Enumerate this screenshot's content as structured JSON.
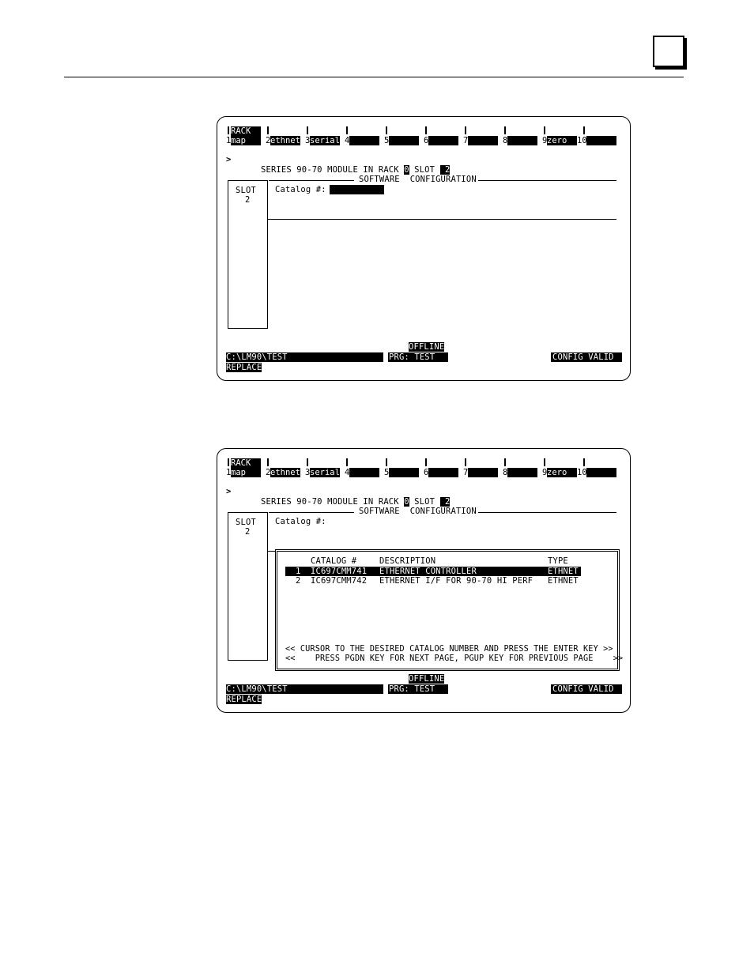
{
  "screens": [
    {
      "fkeys": [
        {
          "num": "1",
          "label": "map",
          "top": "RACK"
        },
        {
          "num": "2",
          "label": "ethnet"
        },
        {
          "num": "3",
          "label": "serial"
        },
        {
          "num": "4",
          "label": ""
        },
        {
          "num": "5",
          "label": ""
        },
        {
          "num": "6",
          "label": ""
        },
        {
          "num": "7",
          "label": ""
        },
        {
          "num": "8",
          "label": ""
        },
        {
          "num": "9",
          "label": "zero"
        },
        {
          "num": "10",
          "label": ""
        }
      ],
      "prompt": ">",
      "module_line": {
        "prefix": "SERIES 90-70 MODULE IN RACK ",
        "rack": "0",
        "slot_label": " SLOT ",
        "slot": " 2"
      },
      "section_title": "SOFTWARE  CONFIGURATION",
      "slot_label": "SLOT",
      "slot_num": "2",
      "catalog_label": "Catalog #:",
      "status": {
        "mode": "OFFLINE",
        "path": "C:\\LM90\\TEST",
        "prg": "PRG: TEST",
        "config": "CONFIG VALID",
        "action": "REPLACE"
      }
    },
    {
      "fkeys": [
        {
          "num": "1",
          "label": "map",
          "top": "RACK"
        },
        {
          "num": "2",
          "label": "ethnet"
        },
        {
          "num": "3",
          "label": "serial"
        },
        {
          "num": "4",
          "label": ""
        },
        {
          "num": "5",
          "label": ""
        },
        {
          "num": "6",
          "label": ""
        },
        {
          "num": "7",
          "label": ""
        },
        {
          "num": "8",
          "label": ""
        },
        {
          "num": "9",
          "label": "zero"
        },
        {
          "num": "10",
          "label": ""
        }
      ],
      "prompt": ">",
      "module_line": {
        "prefix": "SERIES 90-70 MODULE IN RACK ",
        "rack": "0",
        "slot_label": " SLOT ",
        "slot": " 2"
      },
      "section_title": "SOFTWARE  CONFIGURATION",
      "slot_label": "SLOT",
      "slot_num": "2",
      "catalog_label": "Catalog #:",
      "popup": {
        "headers": {
          "catalog": "CATALOG #",
          "description": "DESCRIPTION",
          "type": "TYPE"
        },
        "rows": [
          {
            "num": "1",
            "catalog": "IC697CMM741",
            "description": "ETHERNET CONTROLLER",
            "type": "ETHNET"
          },
          {
            "num": "2",
            "catalog": "IC697CMM742",
            "description": "ETHERNET I/F FOR 90-70 HI PERF",
            "type": "ETHNET"
          }
        ],
        "help1": "<< CURSOR TO THE DESIRED CATALOG NUMBER AND PRESS THE ENTER KEY >>",
        "help2": "<<    PRESS PGDN KEY FOR NEXT PAGE, PGUP KEY FOR PREVIOUS PAGE    >>"
      },
      "status": {
        "mode": "OFFLINE",
        "path": "C:\\LM90\\TEST",
        "prg": "PRG: TEST",
        "config": "CONFIG VALID",
        "action": "REPLACE"
      }
    }
  ]
}
